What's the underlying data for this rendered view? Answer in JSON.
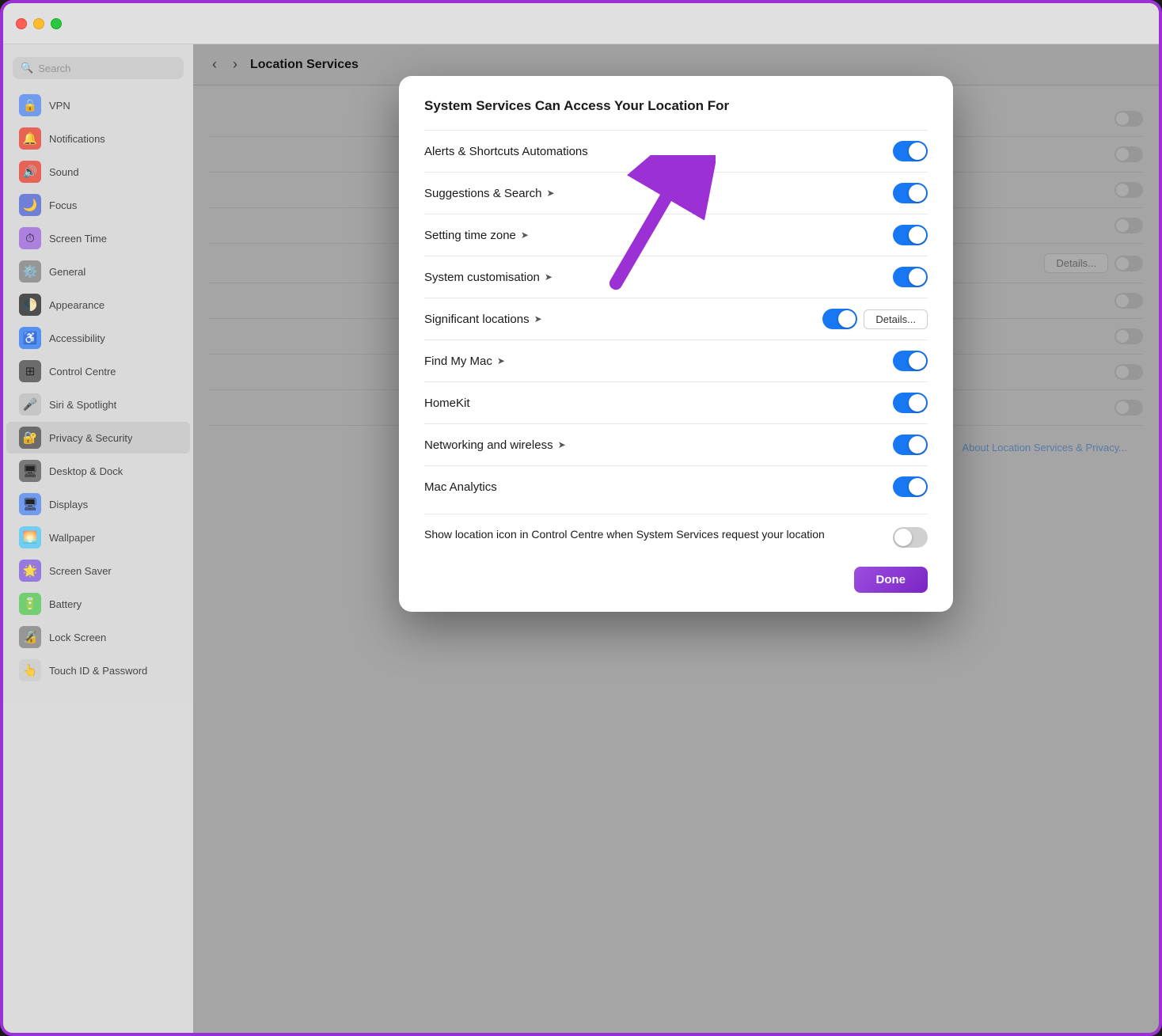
{
  "window": {
    "title": "Location Services"
  },
  "sidebar": {
    "search_placeholder": "Search",
    "items": [
      {
        "id": "vpn",
        "label": "VPN",
        "icon": "🔒",
        "icon_class": "icon-vpn"
      },
      {
        "id": "notifications",
        "label": "Notifications",
        "icon": "🔔",
        "icon_class": "icon-notif"
      },
      {
        "id": "sound",
        "label": "Sound",
        "icon": "🔊",
        "icon_class": "icon-sound"
      },
      {
        "id": "focus",
        "label": "Focus",
        "icon": "🌙",
        "icon_class": "icon-focus"
      },
      {
        "id": "screentime",
        "label": "Screen Time",
        "icon": "⏱",
        "icon_class": "icon-screentime"
      },
      {
        "id": "general",
        "label": "General",
        "icon": "⚙️",
        "icon_class": "icon-general"
      },
      {
        "id": "appearance",
        "label": "Appearance",
        "icon": "🌓",
        "icon_class": "icon-appearance"
      },
      {
        "id": "accessibility",
        "label": "Accessibility",
        "icon": "♿",
        "icon_class": "icon-accessibility"
      },
      {
        "id": "control",
        "label": "Control Centre",
        "icon": "⊞",
        "icon_class": "icon-control"
      },
      {
        "id": "siri",
        "label": "Siri & Spotlight",
        "icon": "🎤",
        "icon_class": "icon-siri"
      },
      {
        "id": "privacy",
        "label": "Privacy & Security",
        "icon": "🔐",
        "icon_class": "icon-privacy",
        "active": true
      },
      {
        "id": "desktop",
        "label": "Desktop & Dock",
        "icon": "🖥",
        "icon_class": "icon-desktop"
      },
      {
        "id": "displays",
        "label": "Displays",
        "icon": "🖥",
        "icon_class": "icon-displays"
      },
      {
        "id": "wallpaper",
        "label": "Wallpaper",
        "icon": "🌅",
        "icon_class": "icon-wallpaper"
      },
      {
        "id": "screensaver",
        "label": "Screen Saver",
        "icon": "🌟",
        "icon_class": "icon-screensaver"
      },
      {
        "id": "battery",
        "label": "Battery",
        "icon": "🔋",
        "icon_class": "icon-battery"
      },
      {
        "id": "lockscreen",
        "label": "Lock Screen",
        "icon": "🔏",
        "icon_class": "icon-lockscreen"
      },
      {
        "id": "touchid",
        "label": "Touch ID & Password",
        "icon": "👆",
        "icon_class": "icon-touchid"
      }
    ]
  },
  "header": {
    "title": "Location Services",
    "back_btn": "‹",
    "forward_btn": "›"
  },
  "modal": {
    "title": "System Services Can Access Your Location For",
    "rows": [
      {
        "id": "alerts",
        "label": "Alerts & Shortcuts Automations",
        "has_arrow": false,
        "toggle": "on",
        "has_details": false
      },
      {
        "id": "suggestions",
        "label": "Suggestions & Search",
        "has_arrow": true,
        "toggle": "on",
        "has_details": false
      },
      {
        "id": "timezone",
        "label": "Setting time zone",
        "has_arrow": true,
        "toggle": "on",
        "has_details": false
      },
      {
        "id": "customisation",
        "label": "System customisation",
        "has_arrow": true,
        "toggle": "on",
        "has_details": false
      },
      {
        "id": "locations",
        "label": "Significant locations",
        "has_arrow": true,
        "toggle": "on",
        "has_details": true,
        "details_label": "Details..."
      },
      {
        "id": "findmymac",
        "label": "Find My Mac",
        "has_arrow": true,
        "toggle": "on",
        "has_details": false
      },
      {
        "id": "homekit",
        "label": "HomeKit",
        "has_arrow": false,
        "toggle": "on",
        "has_details": false
      },
      {
        "id": "networking",
        "label": "Networking and wireless",
        "has_arrow": true,
        "toggle": "on",
        "has_details": false
      },
      {
        "id": "analytics",
        "label": "Mac Analytics",
        "has_arrow": false,
        "toggle": "on",
        "has_details": false
      }
    ],
    "show_location": {
      "text": "Show location icon in Control Centre when System Services request your location",
      "toggle": "off"
    },
    "done_label": "Done"
  },
  "right_panel": {
    "details_label": "Details...",
    "about_link": "About Location Services & Privacy..."
  }
}
